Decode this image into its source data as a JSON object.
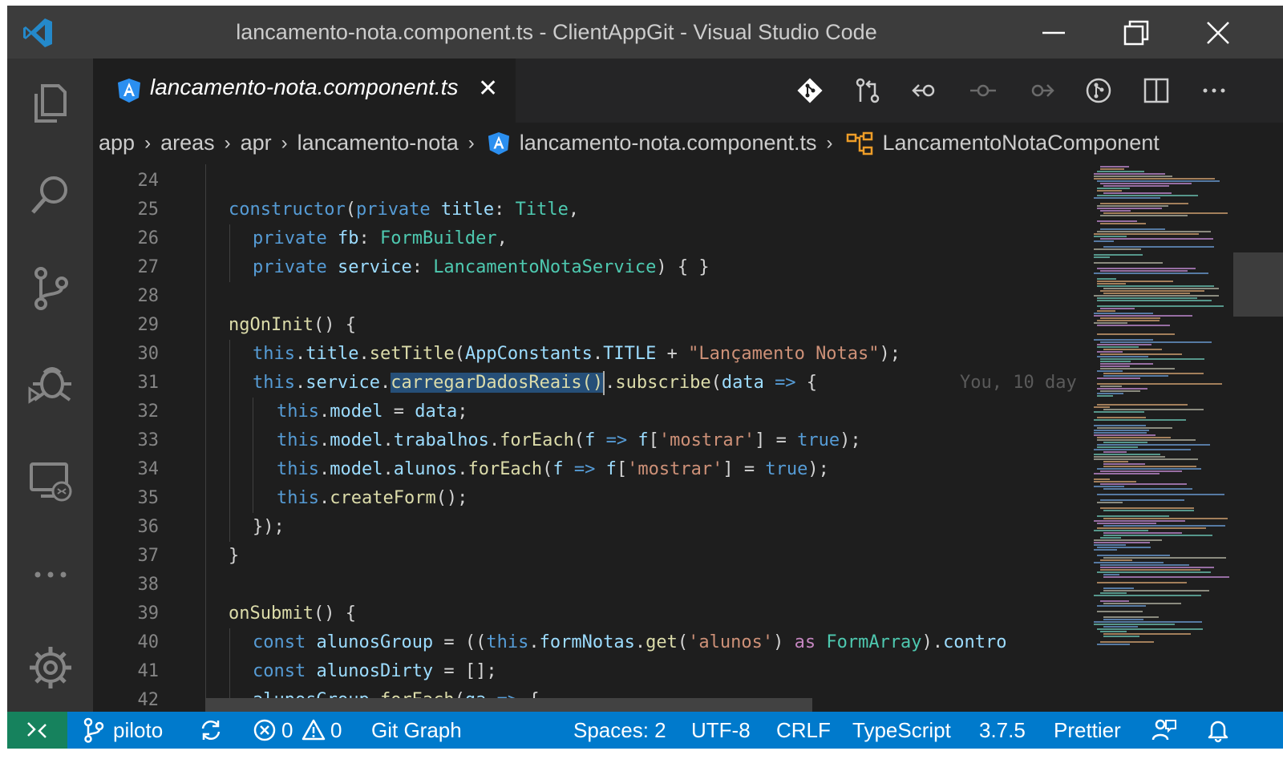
{
  "window": {
    "title": "lancamento-nota.component.ts - ClientAppGit - Visual Studio Code"
  },
  "tab": {
    "label": "lancamento-nota.component.ts",
    "close_glyph": "✕"
  },
  "breadcrumb": {
    "items": [
      "app",
      "areas",
      "apr",
      "lancamento-nota",
      "lancamento-nota.component.ts",
      "LancamentoNotaComponent"
    ],
    "separator": "›"
  },
  "editor": {
    "line_numbers": [
      "24",
      "25",
      "26",
      "27",
      "28",
      "29",
      "30",
      "31",
      "32",
      "33",
      "34",
      "35",
      "36",
      "37",
      "38",
      "39",
      "40",
      "41",
      "42"
    ],
    "blame_text": "You, 10 day",
    "lines": {
      "l25": [
        "constructor",
        "(",
        "private",
        " ",
        "title",
        ": ",
        "Title",
        ","
      ],
      "l26": [
        "private",
        " ",
        "fb",
        ": ",
        "FormBuilder",
        ","
      ],
      "l27": [
        "private",
        " ",
        "service",
        ": ",
        "LancamentoNotaService",
        ") { }"
      ],
      "l29": [
        "ngOnInit",
        "() {"
      ],
      "l30": [
        "this",
        ".",
        "title",
        ".",
        "setTitle",
        "(",
        "AppConstants",
        ".",
        "TITLE",
        " + ",
        "\"Lançamento Notas\"",
        ");"
      ],
      "l31": [
        "this",
        ".",
        "service",
        ".",
        "carregarDadosReais()",
        ".",
        "subscribe",
        "(",
        "data",
        " ",
        "=>",
        " {"
      ],
      "l32": [
        "this",
        ".",
        "model",
        " = ",
        "data",
        ";"
      ],
      "l33": [
        "this",
        ".",
        "model",
        ".",
        "trabalhos",
        ".",
        "forEach",
        "(",
        "f",
        " ",
        "=>",
        " ",
        "f",
        "[",
        "'mostrar'",
        "] = ",
        "true",
        ");"
      ],
      "l34": [
        "this",
        ".",
        "model",
        ".",
        "alunos",
        ".",
        "forEach",
        "(",
        "f",
        " ",
        "=>",
        " ",
        "f",
        "[",
        "'mostrar'",
        "] = ",
        "true",
        ");"
      ],
      "l35": [
        "this",
        ".",
        "createForm",
        "();"
      ],
      "l36": [
        "});"
      ],
      "l37": [
        "}"
      ],
      "l39": [
        "onSubmit",
        "() {"
      ],
      "l40": [
        "const",
        " ",
        "alunosGroup",
        " = ((",
        "this",
        ".",
        "formNotas",
        ".",
        "get",
        "(",
        "'alunos'",
        ") ",
        "as",
        " ",
        "FormArray",
        ").",
        "contro"
      ],
      "l41": [
        "const",
        " ",
        "alunosDirty",
        " = [];"
      ],
      "l42": [
        "alunosGroup",
        ".",
        "forEach",
        "(",
        "ga",
        " ",
        "=>",
        " {"
      ]
    }
  },
  "statusbar": {
    "branch": "piloto",
    "errors": "0",
    "warnings": "0",
    "git_graph": "Git Graph",
    "spaces": "Spaces: 2",
    "encoding": "UTF-8",
    "eol": "CRLF",
    "language": "TypeScript",
    "ts_version": "3.7.5",
    "formatter": "Prettier"
  },
  "colors": {
    "titlebar": "#3c3c3c",
    "activitybar": "#333333",
    "editor_bg": "#1e1e1e",
    "statusbar": "#007acc",
    "remote": "#16825d",
    "angular": "#2b8ff0"
  },
  "icons": {
    "activity": [
      "explorer-icon",
      "search-icon",
      "source-control-icon",
      "debug-icon",
      "remote-explorer-icon",
      "more-icon",
      "settings-gear-icon"
    ],
    "toolbar": [
      "git-icon",
      "compare-changes-icon",
      "go-back-icon",
      "commit-node-icon",
      "go-forward-icon",
      "git-history-icon",
      "split-editor-icon",
      "more-actions-icon"
    ]
  }
}
